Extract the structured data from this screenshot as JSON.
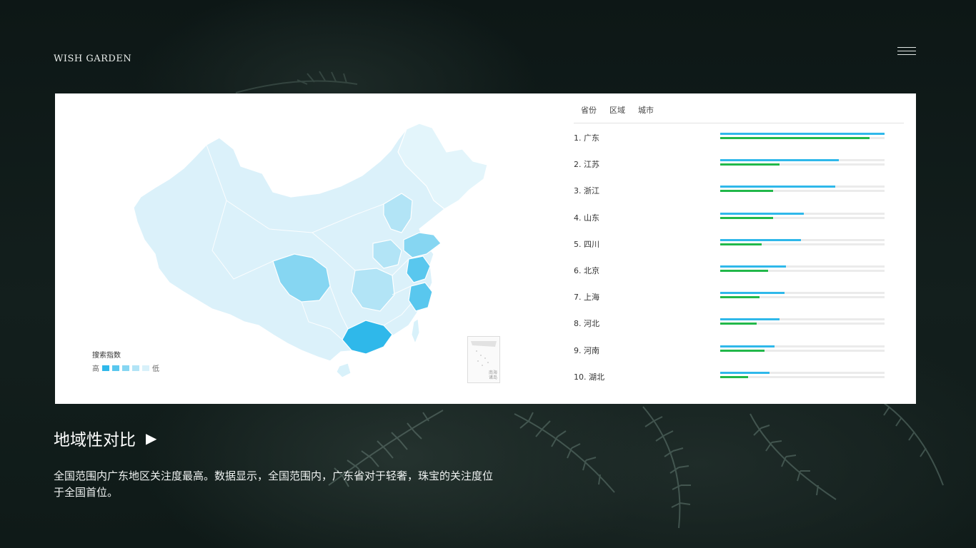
{
  "brand": {
    "logo_text": "WISH GARDEN"
  },
  "menu": {
    "icon": "hamburger-icon"
  },
  "tabs": [
    "省份",
    "区域",
    "城市"
  ],
  "legend": {
    "title": "搜索指数",
    "high": "高",
    "low": "低",
    "colors": [
      "#2fb8ea",
      "#59c7ee",
      "#86d6f2",
      "#b2e4f6",
      "#d8f1fa"
    ]
  },
  "inset": {
    "label_line1": "南海",
    "label_line2": "诸岛"
  },
  "colors": {
    "search_bar": "#2fb8ea",
    "secondary_bar": "#22b84a",
    "track": "#ebebeb",
    "map_base": "#dbf1fa"
  },
  "ranking": [
    {
      "label": "1.  广东",
      "blue": 1.0,
      "green": 0.91
    },
    {
      "label": "2.  江苏",
      "blue": 0.72,
      "green": 0.36
    },
    {
      "label": "3.  浙江",
      "blue": 0.7,
      "green": 0.32
    },
    {
      "label": "4.  山东",
      "blue": 0.51,
      "green": 0.32
    },
    {
      "label": "5.  四川",
      "blue": 0.49,
      "green": 0.25
    },
    {
      "label": "6.  北京",
      "blue": 0.4,
      "green": 0.29
    },
    {
      "label": "7.  上海",
      "blue": 0.39,
      "green": 0.24
    },
    {
      "label": "8.  河北",
      "blue": 0.36,
      "green": 0.22
    },
    {
      "label": "9.  河南",
      "blue": 0.33,
      "green": 0.27
    },
    {
      "label": "10. 湖北",
      "blue": 0.3,
      "green": 0.17
    }
  ],
  "headline": {
    "text": "地域性对比",
    "arrow": "▶"
  },
  "paragraph": "全国范围内广东地区关注度最高。数据显示，全国范围内，广东省对于轻奢，珠宝的关注度位于全国首位。"
}
